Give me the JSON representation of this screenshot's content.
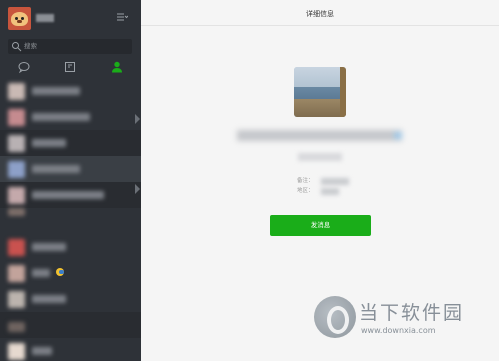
{
  "header": {
    "title": "详细信息"
  },
  "sidebar": {
    "search_placeholder": "搜索",
    "tabs": [
      {
        "name": "chat",
        "icon": "chat-bubble-icon"
      },
      {
        "name": "favorites",
        "icon": "cube-icon"
      },
      {
        "name": "contacts",
        "icon": "person-icon",
        "active": true
      }
    ],
    "menu_icon": "hamburger-menu-icon"
  },
  "profile": {
    "remark_label": "备注：",
    "region_label": "地区："
  },
  "actions": {
    "send_message": "发消息"
  },
  "watermark": {
    "brand": "当下软件园",
    "url": "www.downxia.com"
  },
  "colors": {
    "sidebar_bg": "#2e3238",
    "accent_green": "#1aad19",
    "main_bg": "#f5f5f5"
  }
}
